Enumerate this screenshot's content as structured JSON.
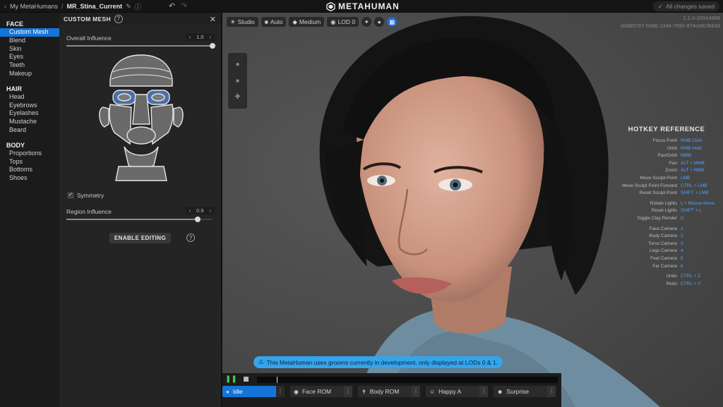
{
  "topbar": {
    "breadcrumb_root": "My MetaHumans",
    "breadcrumb_sep": "/",
    "current_name": "MR_Stina_Current",
    "brand": "METAHUMAN",
    "saved_status": "All changes saved"
  },
  "nav": {
    "face_title": "FACE",
    "face_items": [
      "Custom Mesh",
      "Blend",
      "Skin",
      "Eyes",
      "Teeth",
      "Makeup"
    ],
    "hair_title": "HAIR",
    "hair_items": [
      "Head",
      "Eyebrows",
      "Eyelashes",
      "Mustache",
      "Beard"
    ],
    "body_title": "BODY",
    "body_items": [
      "Proportions",
      "Tops",
      "Bottoms",
      "Shoes"
    ]
  },
  "panel": {
    "title": "CUSTOM MESH",
    "overall_label": "Overall Influence",
    "overall_value": "1.0",
    "overall_level": 1.0,
    "symmetry_label": "Symmetry",
    "symmetry_checked": true,
    "region_label": "Region Influence",
    "region_value": "0.9",
    "region_level": 0.9,
    "enable_label": "ENABLE EDITING"
  },
  "viewport": {
    "toolbar": [
      "Studio",
      "Auto",
      "Medium",
      "LOD 0"
    ],
    "version": "1.1.0-20914998",
    "hash": "d3d95787-50d6-134e-7692-874cb91f663d",
    "hotkey_title": "HOTKEY REFERENCE",
    "hotkeys_a": [
      {
        "k": "Focus Point",
        "v": "RMB Click"
      },
      {
        "k": "Orbit",
        "v": "RMB Hold"
      },
      {
        "k": "Pan/Orbit",
        "v": "MMB"
      },
      {
        "k": "Pan",
        "v": "ALT + MMB"
      },
      {
        "k": "Zoom",
        "v": "ALT + RMB"
      },
      {
        "k": "Move Sculpt Point",
        "v": "LMB"
      },
      {
        "k": "Move Sculpt Point Forward",
        "v": "CTRL + LMB"
      },
      {
        "k": "Reset Sculpt Point",
        "v": "SHIFT + LMB"
      }
    ],
    "hotkeys_b": [
      {
        "k": "Rotate Lights",
        "v": "L + Mouse Move"
      },
      {
        "k": "Reset Lights",
        "v": "SHIFT + L"
      },
      {
        "k": "Toggle Clay Render",
        "v": "C"
      }
    ],
    "hotkeys_c": [
      {
        "k": "Face Camera",
        "v": "1"
      },
      {
        "k": "Body Camera",
        "v": "2"
      },
      {
        "k": "Torso Camera",
        "v": "3"
      },
      {
        "k": "Legs Camera",
        "v": "4"
      },
      {
        "k": "Feet Camera",
        "v": "5"
      },
      {
        "k": "Far Camera",
        "v": "6"
      }
    ],
    "hotkeys_d": [
      {
        "k": "Undo",
        "v": "CTRL + Z"
      },
      {
        "k": "Redo",
        "v": "CTRL + Y"
      }
    ],
    "warning": "This MetaHuman uses grooms currently in development, only displayed at LODs 0 & 1."
  },
  "timeline": {
    "animations": [
      "Idle",
      "Face ROM",
      "Body ROM",
      "Happy A",
      "Surprise"
    ]
  },
  "colors": {
    "accent": "#1474d8",
    "link": "#4da3ff",
    "warning": "#34a4ec"
  }
}
